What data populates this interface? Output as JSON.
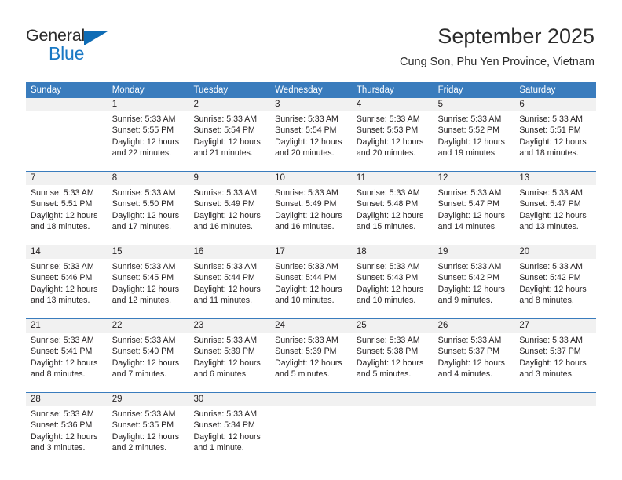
{
  "brand": {
    "name_top": "General",
    "name_bottom": "Blue",
    "accent_color": "#1878c4",
    "triangle_color": "#0f6cb5"
  },
  "header": {
    "title": "September 2025",
    "subtitle": "Cung Son, Phu Yen Province, Vietnam",
    "header_bg": "#3a7cbd",
    "date_band_bg": "#f1f1f1"
  },
  "weekdays": [
    "Sunday",
    "Monday",
    "Tuesday",
    "Wednesday",
    "Thursday",
    "Friday",
    "Saturday"
  ],
  "weeks": [
    {
      "days": [
        {
          "num": "",
          "lines": []
        },
        {
          "num": "1",
          "lines": [
            "Sunrise: 5:33 AM",
            "Sunset: 5:55 PM",
            "Daylight: 12 hours",
            "and 22 minutes."
          ]
        },
        {
          "num": "2",
          "lines": [
            "Sunrise: 5:33 AM",
            "Sunset: 5:54 PM",
            "Daylight: 12 hours",
            "and 21 minutes."
          ]
        },
        {
          "num": "3",
          "lines": [
            "Sunrise: 5:33 AM",
            "Sunset: 5:54 PM",
            "Daylight: 12 hours",
            "and 20 minutes."
          ]
        },
        {
          "num": "4",
          "lines": [
            "Sunrise: 5:33 AM",
            "Sunset: 5:53 PM",
            "Daylight: 12 hours",
            "and 20 minutes."
          ]
        },
        {
          "num": "5",
          "lines": [
            "Sunrise: 5:33 AM",
            "Sunset: 5:52 PM",
            "Daylight: 12 hours",
            "and 19 minutes."
          ]
        },
        {
          "num": "6",
          "lines": [
            "Sunrise: 5:33 AM",
            "Sunset: 5:51 PM",
            "Daylight: 12 hours",
            "and 18 minutes."
          ]
        }
      ]
    },
    {
      "days": [
        {
          "num": "7",
          "lines": [
            "Sunrise: 5:33 AM",
            "Sunset: 5:51 PM",
            "Daylight: 12 hours",
            "and 18 minutes."
          ]
        },
        {
          "num": "8",
          "lines": [
            "Sunrise: 5:33 AM",
            "Sunset: 5:50 PM",
            "Daylight: 12 hours",
            "and 17 minutes."
          ]
        },
        {
          "num": "9",
          "lines": [
            "Sunrise: 5:33 AM",
            "Sunset: 5:49 PM",
            "Daylight: 12 hours",
            "and 16 minutes."
          ]
        },
        {
          "num": "10",
          "lines": [
            "Sunrise: 5:33 AM",
            "Sunset: 5:49 PM",
            "Daylight: 12 hours",
            "and 16 minutes."
          ]
        },
        {
          "num": "11",
          "lines": [
            "Sunrise: 5:33 AM",
            "Sunset: 5:48 PM",
            "Daylight: 12 hours",
            "and 15 minutes."
          ]
        },
        {
          "num": "12",
          "lines": [
            "Sunrise: 5:33 AM",
            "Sunset: 5:47 PM",
            "Daylight: 12 hours",
            "and 14 minutes."
          ]
        },
        {
          "num": "13",
          "lines": [
            "Sunrise: 5:33 AM",
            "Sunset: 5:47 PM",
            "Daylight: 12 hours",
            "and 13 minutes."
          ]
        }
      ]
    },
    {
      "days": [
        {
          "num": "14",
          "lines": [
            "Sunrise: 5:33 AM",
            "Sunset: 5:46 PM",
            "Daylight: 12 hours",
            "and 13 minutes."
          ]
        },
        {
          "num": "15",
          "lines": [
            "Sunrise: 5:33 AM",
            "Sunset: 5:45 PM",
            "Daylight: 12 hours",
            "and 12 minutes."
          ]
        },
        {
          "num": "16",
          "lines": [
            "Sunrise: 5:33 AM",
            "Sunset: 5:44 PM",
            "Daylight: 12 hours",
            "and 11 minutes."
          ]
        },
        {
          "num": "17",
          "lines": [
            "Sunrise: 5:33 AM",
            "Sunset: 5:44 PM",
            "Daylight: 12 hours",
            "and 10 minutes."
          ]
        },
        {
          "num": "18",
          "lines": [
            "Sunrise: 5:33 AM",
            "Sunset: 5:43 PM",
            "Daylight: 12 hours",
            "and 10 minutes."
          ]
        },
        {
          "num": "19",
          "lines": [
            "Sunrise: 5:33 AM",
            "Sunset: 5:42 PM",
            "Daylight: 12 hours",
            "and 9 minutes."
          ]
        },
        {
          "num": "20",
          "lines": [
            "Sunrise: 5:33 AM",
            "Sunset: 5:42 PM",
            "Daylight: 12 hours",
            "and 8 minutes."
          ]
        }
      ]
    },
    {
      "days": [
        {
          "num": "21",
          "lines": [
            "Sunrise: 5:33 AM",
            "Sunset: 5:41 PM",
            "Daylight: 12 hours",
            "and 8 minutes."
          ]
        },
        {
          "num": "22",
          "lines": [
            "Sunrise: 5:33 AM",
            "Sunset: 5:40 PM",
            "Daylight: 12 hours",
            "and 7 minutes."
          ]
        },
        {
          "num": "23",
          "lines": [
            "Sunrise: 5:33 AM",
            "Sunset: 5:39 PM",
            "Daylight: 12 hours",
            "and 6 minutes."
          ]
        },
        {
          "num": "24",
          "lines": [
            "Sunrise: 5:33 AM",
            "Sunset: 5:39 PM",
            "Daylight: 12 hours",
            "and 5 minutes."
          ]
        },
        {
          "num": "25",
          "lines": [
            "Sunrise: 5:33 AM",
            "Sunset: 5:38 PM",
            "Daylight: 12 hours",
            "and 5 minutes."
          ]
        },
        {
          "num": "26",
          "lines": [
            "Sunrise: 5:33 AM",
            "Sunset: 5:37 PM",
            "Daylight: 12 hours",
            "and 4 minutes."
          ]
        },
        {
          "num": "27",
          "lines": [
            "Sunrise: 5:33 AM",
            "Sunset: 5:37 PM",
            "Daylight: 12 hours",
            "and 3 minutes."
          ]
        }
      ]
    },
    {
      "days": [
        {
          "num": "28",
          "lines": [
            "Sunrise: 5:33 AM",
            "Sunset: 5:36 PM",
            "Daylight: 12 hours",
            "and 3 minutes."
          ]
        },
        {
          "num": "29",
          "lines": [
            "Sunrise: 5:33 AM",
            "Sunset: 5:35 PM",
            "Daylight: 12 hours",
            "and 2 minutes."
          ]
        },
        {
          "num": "30",
          "lines": [
            "Sunrise: 5:33 AM",
            "Sunset: 5:34 PM",
            "Daylight: 12 hours",
            "and 1 minute."
          ]
        },
        {
          "num": "",
          "lines": []
        },
        {
          "num": "",
          "lines": []
        },
        {
          "num": "",
          "lines": []
        },
        {
          "num": "",
          "lines": []
        }
      ]
    }
  ]
}
